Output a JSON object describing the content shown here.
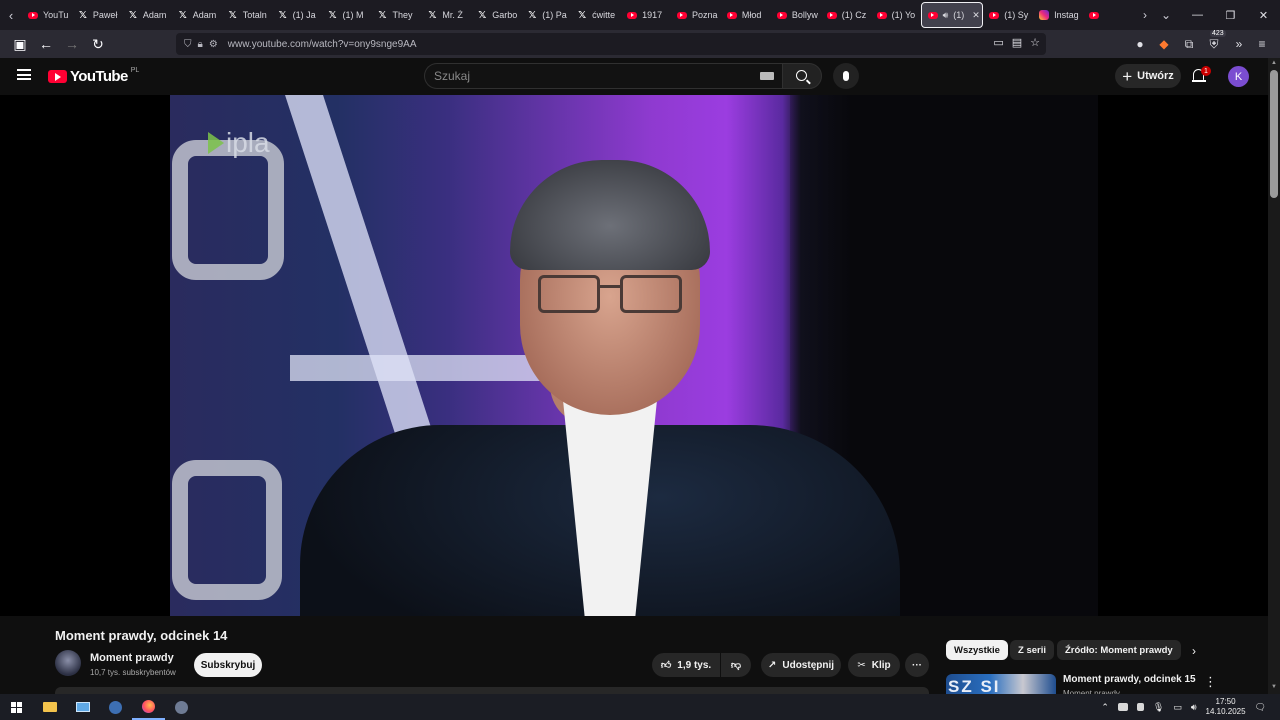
{
  "browser": {
    "tabs": [
      {
        "label": "YouTu",
        "icon": "youtube-icon"
      },
      {
        "label": "Paweł",
        "icon": "x-icon"
      },
      {
        "label": "Adam",
        "icon": "x-icon"
      },
      {
        "label": "Adam",
        "icon": "x-icon"
      },
      {
        "label": "Totaln",
        "icon": "x-icon"
      },
      {
        "label": "(1) Ja",
        "icon": "x-icon"
      },
      {
        "label": "(1) M",
        "icon": "x-icon"
      },
      {
        "label": "They",
        "icon": "x-icon"
      },
      {
        "label": "Mr. Ż",
        "icon": "x-icon"
      },
      {
        "label": "Garbo",
        "icon": "x-icon"
      },
      {
        "label": "(1) Pa",
        "icon": "x-icon"
      },
      {
        "label": "ćwitte",
        "icon": "x-icon"
      },
      {
        "label": "1917",
        "icon": "youtube-icon"
      },
      {
        "label": "Pozna",
        "icon": "youtube-icon"
      },
      {
        "label": "Młod",
        "icon": "youtube-icon"
      },
      {
        "label": "Bollyw",
        "icon": "youtube-icon"
      },
      {
        "label": "(1) Cz",
        "icon": "youtube-icon"
      },
      {
        "label": "(1) Yo",
        "icon": "youtube-icon"
      },
      {
        "label": "(1)",
        "icon": "youtube-icon",
        "active": true
      },
      {
        "label": "(1) Sy",
        "icon": "youtube-icon"
      },
      {
        "label": "Instag",
        "icon": "instagram-icon"
      },
      {
        "label": "",
        "icon": "youtube-icon"
      }
    ],
    "url": "www.youtube.com/watch?v=ony9snge9AA",
    "extensions_badge": "423"
  },
  "youtube": {
    "logo_text": "YouTube",
    "country": "PL",
    "search_placeholder": "Szukaj",
    "create_label": "Utwórz",
    "notifications_count": "1",
    "avatar_letter": "K",
    "player": {
      "watermark": "ipla"
    },
    "video": {
      "title": "Moment prawdy, odcinek 14",
      "channel_name": "Moment prawdy",
      "subscribers": "10,7 tys. subskrybentów",
      "subscribe_label": "Subskrybuj",
      "likes": "1,9 tys.",
      "share_label": "Udostępnij",
      "clip_label": "Klip",
      "more_label": "···"
    },
    "chips": [
      {
        "label": "Wszystkie",
        "selected": true
      },
      {
        "label": "Z serii",
        "selected": false
      },
      {
        "label": "Źródło: Moment prawdy",
        "selected": false
      }
    ],
    "recommendation": {
      "thumb_text": "SZ  SI",
      "title": "Moment prawdy, odcinek 15",
      "channel": "Moment prawdy"
    }
  },
  "taskbar": {
    "time": "17:50",
    "date": "14.10.2025"
  },
  "colors": {
    "youtube_red": "#ff0033",
    "background": "#0f0f0f",
    "avatar": "#7b4dd1"
  }
}
